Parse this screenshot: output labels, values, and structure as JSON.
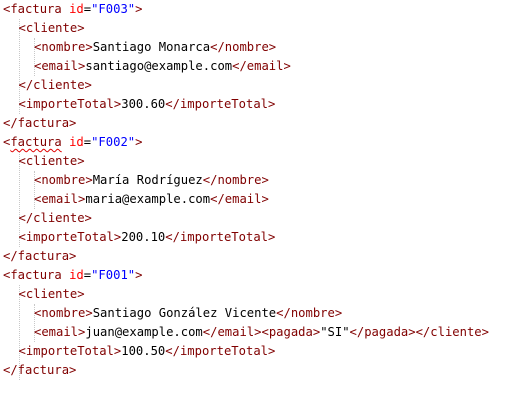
{
  "lines": [
    {
      "indent": 0,
      "parts": [
        {
          "t": "<",
          "c": "tag"
        },
        {
          "t": "factura",
          "c": "tag"
        },
        {
          "t": " ",
          "c": "txt"
        },
        {
          "t": "id",
          "c": "attr"
        },
        {
          "t": "=",
          "c": "txt"
        },
        {
          "t": "\"F003\"",
          "c": "str"
        },
        {
          "t": ">",
          "c": "tag"
        }
      ]
    },
    {
      "indent": 1,
      "parts": [
        {
          "t": "<cliente>",
          "c": "tag"
        }
      ]
    },
    {
      "indent": 2,
      "parts": [
        {
          "t": "<nombre>",
          "c": "tag"
        },
        {
          "t": "Santiago Monarca",
          "c": "txt"
        },
        {
          "t": "</nombre>",
          "c": "tag"
        }
      ]
    },
    {
      "indent": 2,
      "parts": [
        {
          "t": "<email>",
          "c": "tag"
        },
        {
          "t": "santiago@example.com",
          "c": "txt"
        },
        {
          "t": "</email>",
          "c": "tag"
        }
      ]
    },
    {
      "indent": 1,
      "parts": [
        {
          "t": "</cliente>",
          "c": "tag"
        }
      ]
    },
    {
      "indent": 1,
      "parts": [
        {
          "t": "<importeTotal>",
          "c": "tag"
        },
        {
          "t": "300.60",
          "c": "txt"
        },
        {
          "t": "</importeTotal>",
          "c": "tag"
        }
      ]
    },
    {
      "indent": 0,
      "parts": [
        {
          "t": "</factura>",
          "c": "tag"
        }
      ]
    },
    {
      "indent": 0,
      "parts": [
        {
          "t": "<",
          "c": "tag"
        },
        {
          "t": "factura",
          "c": "tag squiggle"
        },
        {
          "t": " ",
          "c": "txt"
        },
        {
          "t": "id",
          "c": "attr"
        },
        {
          "t": "=",
          "c": "txt"
        },
        {
          "t": "\"F002\"",
          "c": "str"
        },
        {
          "t": ">",
          "c": "tag"
        }
      ]
    },
    {
      "indent": 1,
      "parts": [
        {
          "t": "<cliente>",
          "c": "tag"
        }
      ]
    },
    {
      "indent": 2,
      "parts": [
        {
          "t": "<nombre>",
          "c": "tag"
        },
        {
          "t": "María Rodríguez",
          "c": "txt"
        },
        {
          "t": "</nombre>",
          "c": "tag"
        }
      ]
    },
    {
      "indent": 2,
      "parts": [
        {
          "t": "<email>",
          "c": "tag"
        },
        {
          "t": "maria@example.com",
          "c": "txt"
        },
        {
          "t": "</email>",
          "c": "tag"
        }
      ]
    },
    {
      "indent": 1,
      "parts": [
        {
          "t": "</cliente>",
          "c": "tag"
        }
      ]
    },
    {
      "indent": 1,
      "parts": [
        {
          "t": "<importeTotal>",
          "c": "tag"
        },
        {
          "t": "200.10",
          "c": "txt"
        },
        {
          "t": "</importeTotal>",
          "c": "tag"
        }
      ]
    },
    {
      "indent": 0,
      "parts": [
        {
          "t": "</factura>",
          "c": "tag"
        }
      ]
    },
    {
      "indent": 0,
      "parts": [
        {
          "t": "<",
          "c": "tag"
        },
        {
          "t": "factura",
          "c": "tag"
        },
        {
          "t": " ",
          "c": "txt"
        },
        {
          "t": "id",
          "c": "attr"
        },
        {
          "t": "=",
          "c": "txt"
        },
        {
          "t": "\"F001\"",
          "c": "str"
        },
        {
          "t": ">",
          "c": "tag"
        }
      ]
    },
    {
      "indent": 1,
      "parts": [
        {
          "t": "<cliente>",
          "c": "tag"
        }
      ]
    },
    {
      "indent": 2,
      "parts": [
        {
          "t": "<nombre>",
          "c": "tag"
        },
        {
          "t": "Santiago González Vicente",
          "c": "txt"
        },
        {
          "t": "</nombre>",
          "c": "tag"
        }
      ]
    },
    {
      "indent": 2,
      "parts": [
        {
          "t": "<email>",
          "c": "tag"
        },
        {
          "t": "juan@example.com",
          "c": "txt"
        },
        {
          "t": "</email>",
          "c": "tag"
        },
        {
          "t": "<pagada>",
          "c": "tag"
        },
        {
          "t": "\"SI\"",
          "c": "txt"
        },
        {
          "t": "</pagada>",
          "c": "tag"
        },
        {
          "t": "</cliente>",
          "c": "tag"
        }
      ]
    },
    {
      "indent": 1,
      "parts": [
        {
          "t": "<importeTotal>",
          "c": "tag"
        },
        {
          "t": "100.50",
          "c": "txt"
        },
        {
          "t": "</importeTotal>",
          "c": "tag"
        }
      ]
    },
    {
      "indent": 0,
      "parts": [
        {
          "t": "</factura>",
          "c": "tag"
        }
      ]
    }
  ],
  "colors": {
    "tag": "#800000",
    "attribute": "#ff0000",
    "string": "#0000ff",
    "text": "#000000",
    "error_underline": "#e00000"
  }
}
